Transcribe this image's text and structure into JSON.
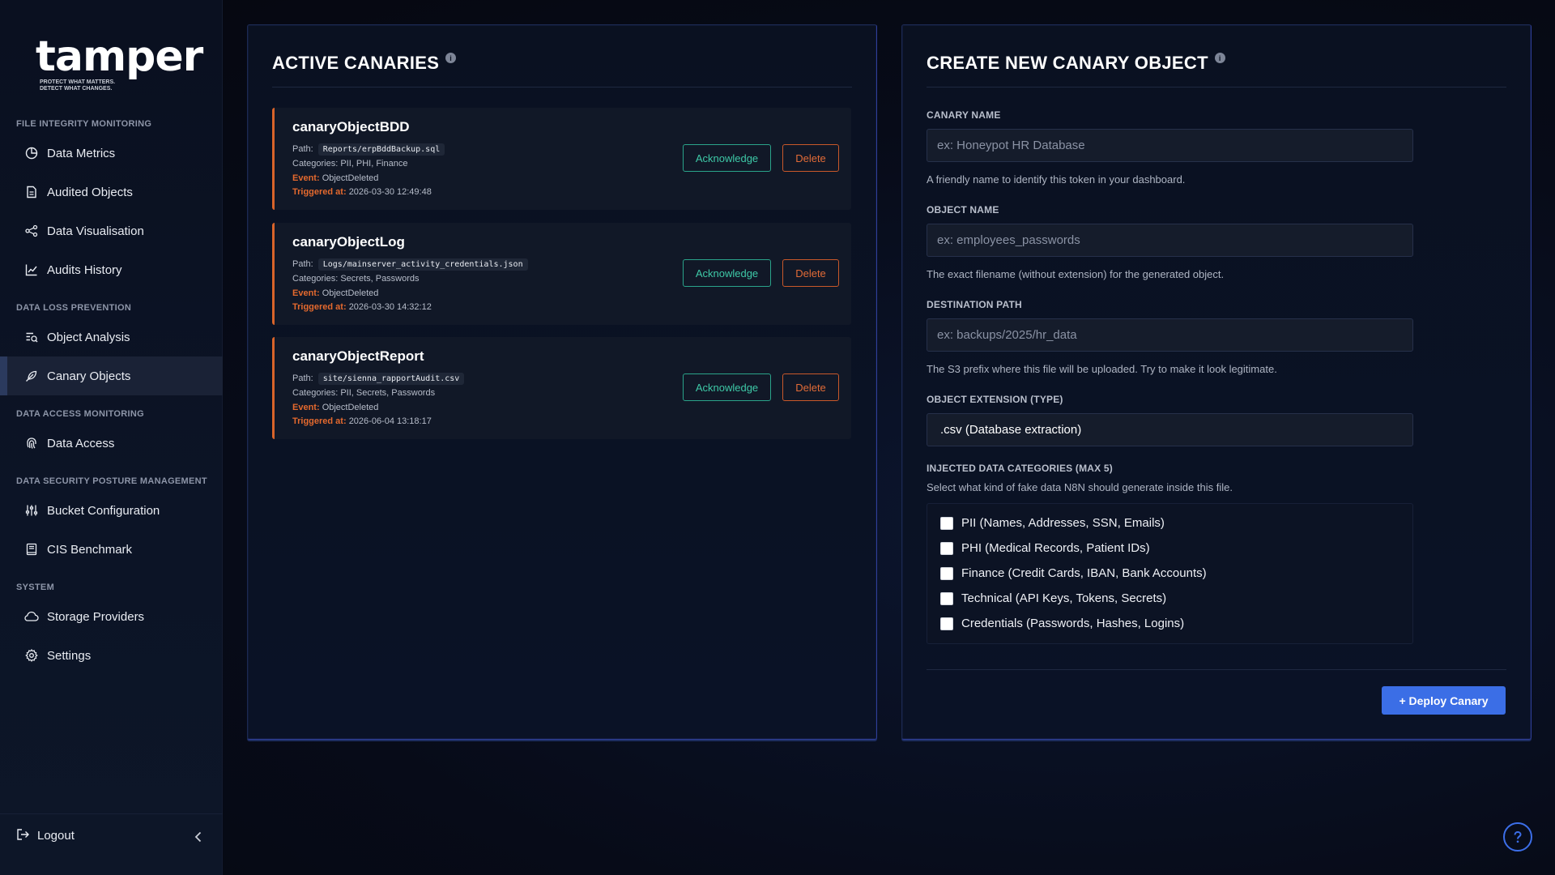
{
  "brand": {
    "name": "tamper",
    "tagline1": "PROTECT WHAT MATTERS.",
    "tagline2": "DETECT WHAT CHANGES."
  },
  "sidebar": {
    "sections": [
      {
        "title": "FILE INTEGRITY MONITORING"
      },
      {
        "title": "DATA LOSS PREVENTION"
      },
      {
        "title": "DATA ACCESS MONITORING"
      },
      {
        "title": "DATA SECURITY POSTURE MANAGEMENT"
      },
      {
        "title": "SYSTEM"
      }
    ],
    "items": [
      {
        "label": "Data Metrics",
        "icon": "pie-chart-icon"
      },
      {
        "label": "Audited Objects",
        "icon": "document-icon"
      },
      {
        "label": "Data Visualisation",
        "icon": "graph-nodes-icon"
      },
      {
        "label": "Audits History",
        "icon": "line-chart-icon"
      },
      {
        "label": "Object Analysis",
        "icon": "list-search-icon"
      },
      {
        "label": "Canary Objects",
        "icon": "feather-icon",
        "active": true
      },
      {
        "label": "Data Access",
        "icon": "fingerprint-icon"
      },
      {
        "label": "Bucket Configuration",
        "icon": "sliders-icon"
      },
      {
        "label": "CIS Benchmark",
        "icon": "book-icon"
      },
      {
        "label": "Storage Providers",
        "icon": "cloud-icon"
      },
      {
        "label": "Settings",
        "icon": "gear-icon"
      }
    ],
    "logout_label": "Logout"
  },
  "active_canaries": {
    "title": "ACTIVE CANARIES",
    "path_label": "Path:",
    "categories_label": "Categories:",
    "event_label": "Event:",
    "triggered_label": "Triggered at:",
    "acknowledge_label": "Acknowledge",
    "delete_label": "Delete",
    "items": [
      {
        "name": "canaryObjectBDD",
        "path": "Reports/erpBddBackup.sql",
        "categories": "PII, PHI, Finance",
        "event": "ObjectDeleted",
        "triggered": "2026-03-30 12:49:48"
      },
      {
        "name": "canaryObjectLog",
        "path": "Logs/mainserver_activity_credentials.json",
        "categories": "Secrets, Passwords",
        "event": "ObjectDeleted",
        "triggered": "2026-03-30 14:32:12"
      },
      {
        "name": "canaryObjectReport",
        "path": "site/sienna_rapportAudit.csv",
        "categories": "PII, Secrets, Passwords",
        "event": "ObjectDeleted",
        "triggered": "2026-06-04 13:18:17"
      }
    ]
  },
  "create_form": {
    "title": "CREATE NEW CANARY OBJECT",
    "canary_name": {
      "label": "CANARY NAME",
      "placeholder": "ex: Honeypot HR Database",
      "value": "",
      "help": "A friendly name to identify this token in your dashboard."
    },
    "object_name": {
      "label": "OBJECT NAME",
      "placeholder": "ex: employees_passwords",
      "value": "",
      "help": "The exact filename (without extension) for the generated object."
    },
    "destination_path": {
      "label": "DESTINATION PATH",
      "placeholder": "ex: backups/2025/hr_data",
      "value": "",
      "help": "The S3 prefix where this file will be uploaded. Try to make it look legitimate."
    },
    "extension": {
      "label": "OBJECT EXTENSION (TYPE)",
      "value": ".csv (Database extraction)"
    },
    "categories": {
      "label": "INJECTED DATA CATEGORIES (MAX 5)",
      "help": "Select what kind of fake data N8N should generate inside this file.",
      "options": [
        {
          "label": "PII (Names, Addresses, SSN, Emails)",
          "checked": false
        },
        {
          "label": "PHI (Medical Records, Patient IDs)",
          "checked": false
        },
        {
          "label": "Finance (Credit Cards, IBAN, Bank Accounts)",
          "checked": false
        },
        {
          "label": "Technical (API Keys, Tokens, Secrets)",
          "checked": false
        },
        {
          "label": "Credentials (Passwords, Hashes, Logins)",
          "checked": false
        }
      ]
    },
    "deploy_label": "+ Deploy Canary"
  },
  "colors": {
    "accent": "#3b6ee6",
    "warning": "#d9642a",
    "success": "#2aa38a"
  }
}
